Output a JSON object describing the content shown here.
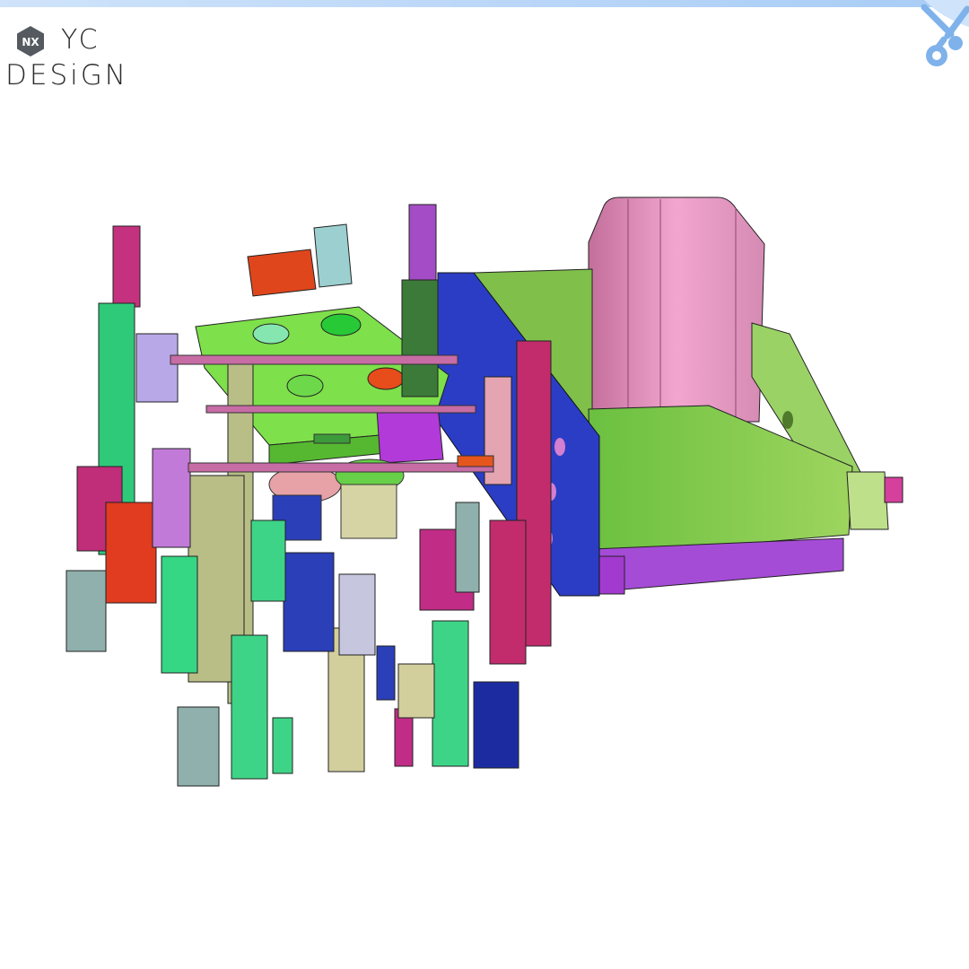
{
  "logo": {
    "badge_text": "NX",
    "line1": "YC",
    "line2": "DESiGN"
  },
  "icons": {
    "corner": "scissors-icon",
    "badge": "nx-hexagon-icon"
  },
  "colors": {
    "top_bar": "#a9cdf6",
    "accent": "#7fb2ea",
    "background": "#ffffff"
  }
}
